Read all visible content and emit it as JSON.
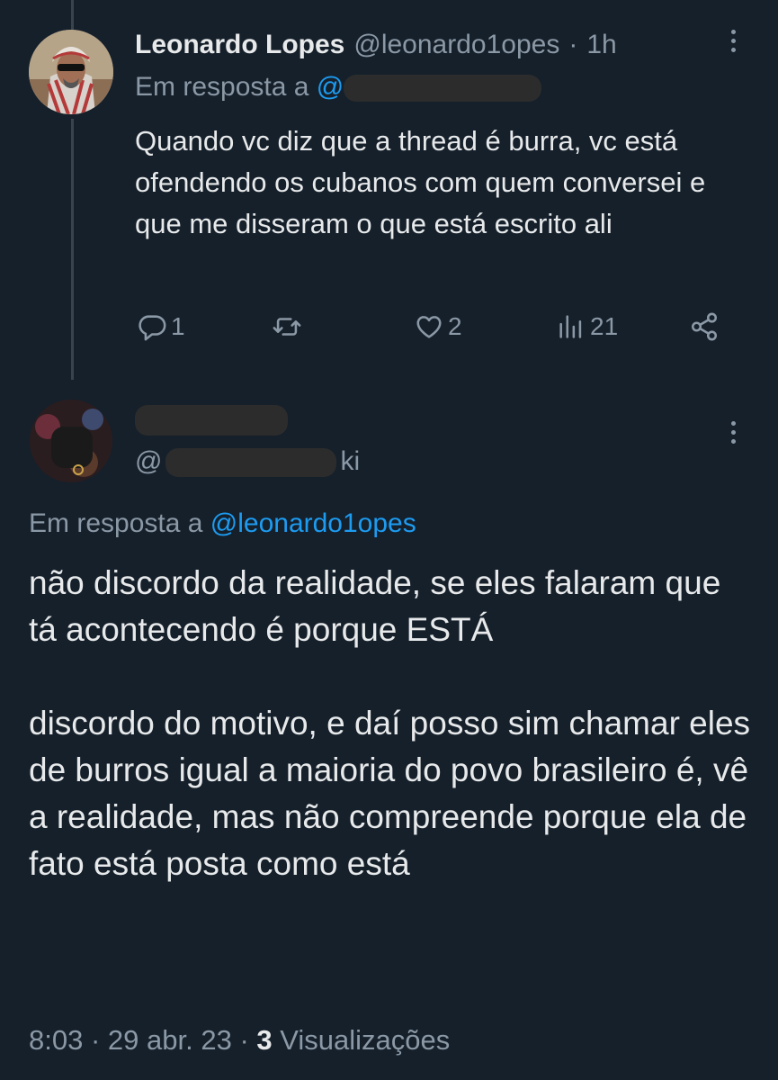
{
  "tweet1": {
    "display_name": "Leonardo Lopes",
    "handle": "@leonardo1opes",
    "separator": "·",
    "time": "1h",
    "reply_prefix": "Em resposta a",
    "reply_mention_visible": "@",
    "text": "Quando vc diz que a thread é burra, vc está ofendendo os cubanos com quem conversei e que me disseram o que está escrito ali",
    "actions": {
      "reply": {
        "icon": "reply-icon",
        "count": "1"
      },
      "retweet": {
        "icon": "retweet-icon",
        "count": ""
      },
      "like": {
        "icon": "heart-icon",
        "count": "2"
      },
      "views": {
        "icon": "views-icon",
        "count": "21"
      },
      "share": {
        "icon": "share-icon"
      }
    }
  },
  "tweet2": {
    "handle_visible_start": "@",
    "handle_visible_end": "ki",
    "reply_prefix": "Em resposta a",
    "reply_mention": "@leonardo1opes",
    "text": "não discordo da realidade, se eles falaram que tá acontecendo é porque ESTÁ\n\ndiscordo do motivo, e daí posso sim chamar eles de burros igual a maioria do povo brasileiro é, vê a realidade, mas não compreende porque ela de fato está posta como está",
    "time": "8:03",
    "separator": "·",
    "date": "29 abr. 23",
    "views_count": "3",
    "views_label": "Visualizações"
  },
  "colors": {
    "background": "#15202b",
    "text": "#e7e9ea",
    "secondary": "#8b98a5",
    "link": "#1d9bf0"
  }
}
